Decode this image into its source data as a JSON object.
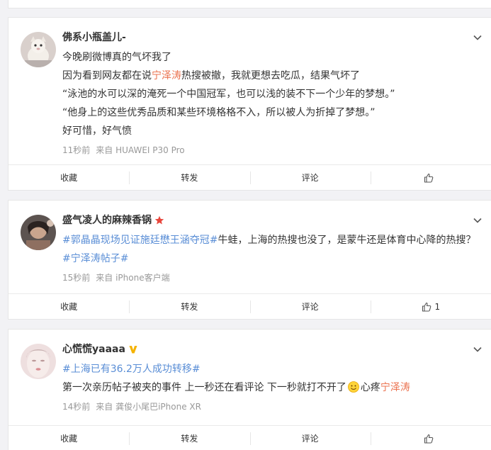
{
  "actions": {
    "favorite_label": "收藏",
    "repost_label": "转发",
    "comment_label": "评论"
  },
  "posts": [
    {
      "username": "佛系小瓶盖儿-",
      "lines": [
        {
          "a": "今晚刷微博真的气坏我了"
        },
        {
          "a": "因为看到网友都在说",
          "hl": "宁泽涛",
          "b": "热搜被撤，我就更想去吃瓜，结果气坏了"
        },
        {
          "a": "“泳池的水可以深的淹死一个中国冠军，也可以浅的装不下一个少年的梦想。”"
        },
        {
          "a": "“他身上的这些优秀品质和某些环境格格不入，所以被人为折掉了梦想。”"
        },
        {
          "a": "好可惜，好气愤"
        }
      ],
      "time": "11秒前",
      "source": "来自 HUAWEI P30 Pro",
      "likes": ""
    },
    {
      "username": "盛气凌人的麻辣香锅",
      "tag1": "#郭晶晶现场见证施廷懋王涵夺冠#",
      "text1": "牛蛙，上海的热搜也没了，是蒙牛还是体育中心降的热搜？",
      "tag2": "#宁泽涛帖子#",
      "time": "15秒前",
      "source": "来自 iPhone客户端",
      "likes": "1"
    },
    {
      "username": "心慌慌yaaaa",
      "tag1": "#上海已有36.2万人成功转移#",
      "text1": "第一次亲历帖子被夹的事件 上一秒还在看评论 下一秒就打不开了",
      "text2": "心疼",
      "hl": "宁泽涛",
      "time": "14秒前",
      "source": "来自 龚俊小尾巴iPhone XR",
      "likes": ""
    }
  ],
  "colors": {
    "highlight": "#eb7350",
    "topic": "#5a8ed6",
    "meta": "#999999",
    "vip_star": "#e8463c",
    "verified": "#f5b300"
  }
}
